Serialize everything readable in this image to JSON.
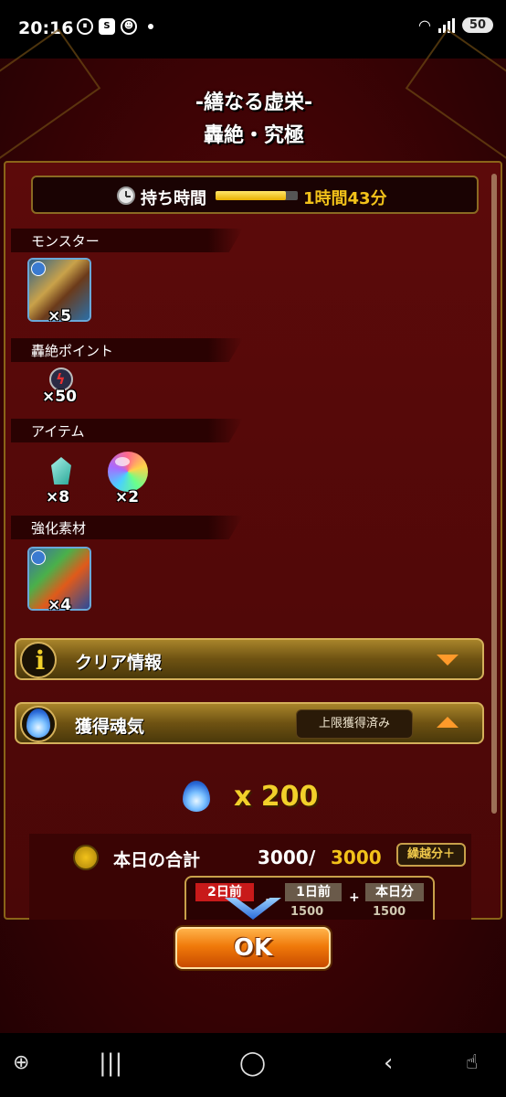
{
  "status_bar": {
    "time": "20:16",
    "notif_icons": [
      "pause-icon",
      "s-app-icon",
      "ghost-icon"
    ],
    "battery": "50"
  },
  "game": {
    "title_line1": "-繕なる虚栄-",
    "title_line2": "轟絶・究極",
    "time_label": "持ち時間",
    "time_value": "1時間43分",
    "time_fill_fraction": 0.85,
    "sections": {
      "monster": "モンスター",
      "points": "轟絶ポイント",
      "items": "アイテム",
      "materials": "強化素材"
    },
    "monster_count": "×5",
    "points_count": "×50",
    "item_gem_count": "×8",
    "item_orb_count": "×2",
    "material_count": "×4",
    "clear_info_label": "クリア情報",
    "soul_label": "獲得魂気",
    "limit_badge": "上限獲得済み",
    "soul_amount": "x 200",
    "total": {
      "label": "本日の合計",
      "current": "3000",
      "separator": "/",
      "max": "3000",
      "carry_badge": "繰越分＋"
    },
    "days": {
      "two_days_ago": "2日前",
      "one_day_ago": "1日前",
      "today": "本日分",
      "sep1": ",",
      "sep2": "+",
      "val1": "1500",
      "val2": "1500"
    },
    "ok_label": "OK"
  },
  "colors": {
    "accent_gold": "#f2c21a",
    "panel_bg": "#4a0707",
    "ok_orange": "#f07a0a"
  }
}
